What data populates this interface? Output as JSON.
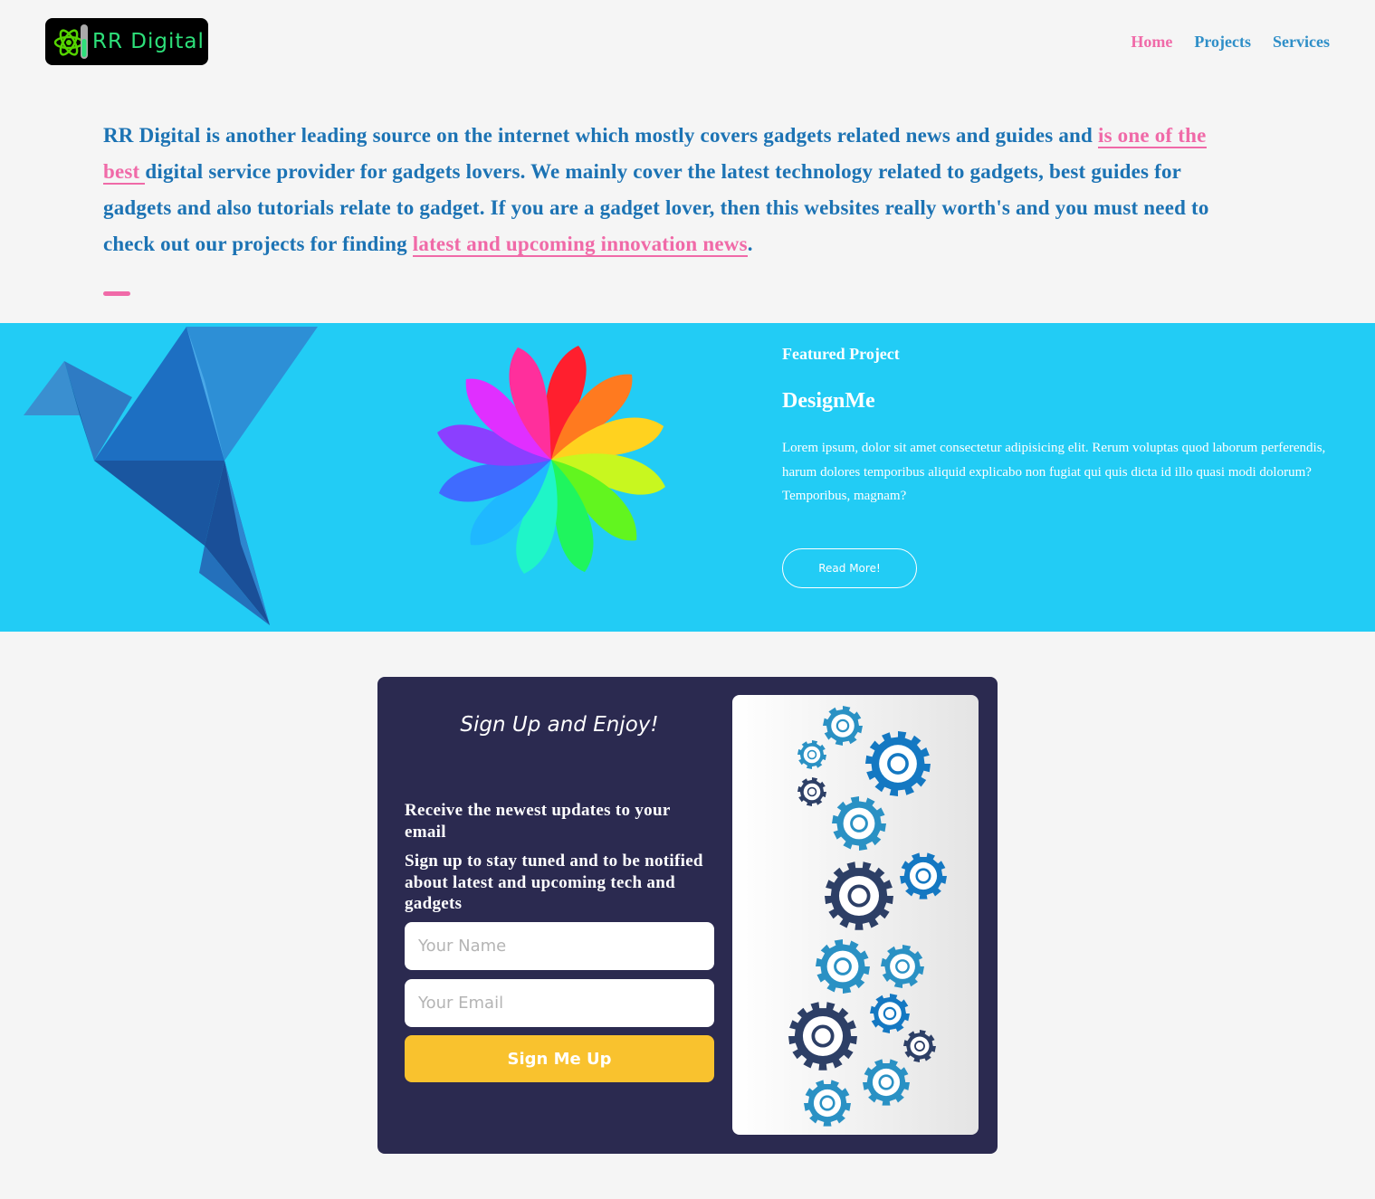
{
  "header": {
    "logo_text": "RR Digital",
    "nav": [
      {
        "label": "Home"
      },
      {
        "label": "Projects"
      },
      {
        "label": "Services"
      }
    ]
  },
  "intro": {
    "text1": "RR Digital is another leading source on the internet which mostly covers gadgets related news and guides and ",
    "link1": "is one of the best ",
    "text2": "digital service provider for gadgets lovers. We mainly cover the latest technology related to gadgets, best guides for gadgets and also tutorials relate to gadget. If you are a gadget lover, then this websites really worth's and you must need to check out our projects for finding ",
    "link2": "latest and upcoming innovation news",
    "text3": "."
  },
  "featured": {
    "kicker": "Featured Project",
    "title": "DesignMe",
    "description": "Lorem ipsum, dolor sit amet consectetur adipisicing elit. Rerum voluptas quod laborum perferendis, harum dolores temporibus aliquid explicabo non fugiat qui quis dicta id illo quasi modi dolorum? Temporibus, magnam?",
    "button": "Read More!"
  },
  "signup": {
    "heading": "Sign Up and Enjoy!",
    "lead": "Receive the newest updates to your email",
    "sub": "Sign up to stay tuned and to be notified about latest and upcoming tech and gadgets",
    "name_placeholder": "Your Name",
    "email_placeholder": "Your Email",
    "button": "Sign Me Up"
  },
  "colors": {
    "accent_pink": "#f06aa8",
    "nav_blue": "#2f8fc8",
    "text_blue": "#1c73b4",
    "band_cyan": "#22ccf5",
    "card_navy": "#2b2a50",
    "button_yellow": "#f9c22e"
  },
  "icons": [
    "atom-test-tube-logo-icon",
    "origami-bird-illustration",
    "rainbow-flower-illustration",
    "tech-gears-illustration"
  ]
}
